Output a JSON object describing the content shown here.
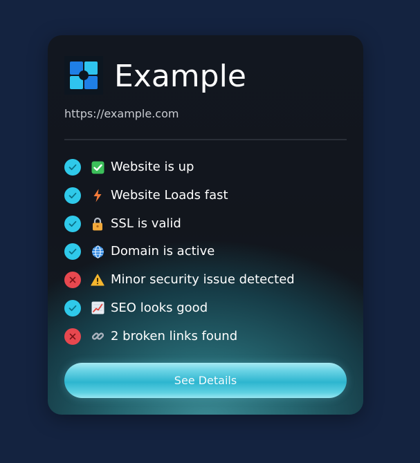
{
  "site": {
    "name": "Example",
    "url": "https://example.com",
    "logo_icon": "grid-logo-icon"
  },
  "checks": [
    {
      "status": "pass",
      "status_icon": "check-icon",
      "emoji_icon": "check-box-icon",
      "label": "Website is up"
    },
    {
      "status": "pass",
      "status_icon": "check-icon",
      "emoji_icon": "lightning-icon",
      "label": "Website Loads fast"
    },
    {
      "status": "pass",
      "status_icon": "check-icon",
      "emoji_icon": "lock-icon",
      "label": "SSL is valid"
    },
    {
      "status": "pass",
      "status_icon": "check-icon",
      "emoji_icon": "globe-icon",
      "label": "Domain is active"
    },
    {
      "status": "fail",
      "status_icon": "x-icon",
      "emoji_icon": "warning-icon",
      "label": "Minor security issue detected"
    },
    {
      "status": "pass",
      "status_icon": "check-icon",
      "emoji_icon": "chart-up-icon",
      "label": "SEO looks good"
    },
    {
      "status": "fail",
      "status_icon": "x-icon",
      "emoji_icon": "link-icon",
      "label": "2 broken links found"
    }
  ],
  "button": {
    "label": "See Details"
  },
  "colors": {
    "page_background": "#142340",
    "pass": "#2fc9ea",
    "fail": "#e7484f",
    "button_accent": "#2db5cf"
  }
}
